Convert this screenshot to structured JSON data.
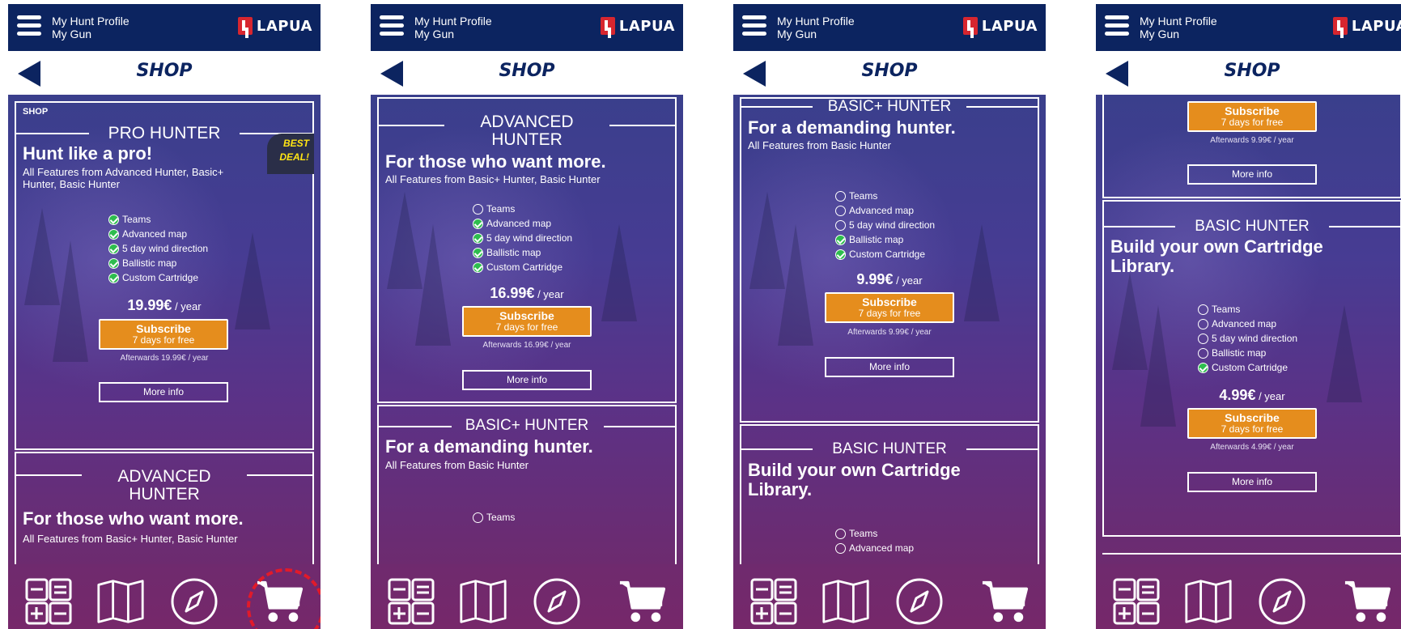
{
  "header": {
    "menu_links": [
      "My Hunt Profile",
      "My Gun"
    ],
    "brand": "LAPUA",
    "title": "SHOP"
  },
  "labels": {
    "subscribe": "Subscribe",
    "trial": "7 days for free",
    "more_info": "More info",
    "afterwards_prefix": "Afterwards",
    "per_year": "/ year",
    "shop_small": "SHOP",
    "best_deal_line1": "BEST",
    "best_deal_line2": "DEAL!"
  },
  "plans": {
    "pro": {
      "name": "PRO HUNTER",
      "tagline": "Hunt like a pro!",
      "includes": "All Features from Advanced Hunter, Basic+ Hunter, Basic Hunter",
      "price": "19.99€",
      "afterwards_price": "19.99€",
      "features": [
        {
          "label": "Teams",
          "checked": true
        },
        {
          "label": "Advanced map",
          "checked": true
        },
        {
          "label": "5 day wind direction",
          "checked": true
        },
        {
          "label": "Ballistic map",
          "checked": true
        },
        {
          "label": "Custom Cartridge",
          "checked": true
        }
      ]
    },
    "advanced": {
      "name_line1": "ADVANCED",
      "name_line2": "HUNTER",
      "tagline": "For those who want more.",
      "includes": "All Features from Basic+ Hunter, Basic Hunter",
      "price": "16.99€",
      "afterwards_price": "16.99€",
      "features": [
        {
          "label": "Teams",
          "checked": false
        },
        {
          "label": "Advanced map",
          "checked": true
        },
        {
          "label": "5 day wind direction",
          "checked": true
        },
        {
          "label": "Ballistic map",
          "checked": true
        },
        {
          "label": "Custom Cartridge",
          "checked": true
        }
      ]
    },
    "basicplus": {
      "name": "BASIC+ HUNTER",
      "tagline": "For a demanding hunter.",
      "includes": "All Features from Basic Hunter",
      "price": "9.99€",
      "afterwards_price": "9.99€",
      "features": [
        {
          "label": "Teams",
          "checked": false
        },
        {
          "label": "Advanced map",
          "checked": false
        },
        {
          "label": "5 day wind direction",
          "checked": false
        },
        {
          "label": "Ballistic map",
          "checked": true
        },
        {
          "label": "Custom Cartridge",
          "checked": true
        }
      ]
    },
    "basic": {
      "name": "BASIC HUNTER",
      "tagline_line1": "Build your own Cartridge",
      "tagline_line2": "Library.",
      "price": "4.99€",
      "afterwards_price": "4.99€",
      "features": [
        {
          "label": "Teams",
          "checked": false
        },
        {
          "label": "Advanced map",
          "checked": false
        },
        {
          "label": "5 day wind direction",
          "checked": false
        },
        {
          "label": "Ballistic map",
          "checked": false
        },
        {
          "label": "Custom Cartridge",
          "checked": true
        }
      ]
    }
  },
  "bottom_nav": [
    "calculator-icon",
    "map-icon",
    "compass-icon",
    "cart-icon"
  ],
  "colors": {
    "navy": "#0c2460",
    "orange": "#e58d1d",
    "check_green": "#2ebd4e",
    "best_deal_yellow": "#ffe414",
    "highlight_red": "#e11a2a"
  }
}
